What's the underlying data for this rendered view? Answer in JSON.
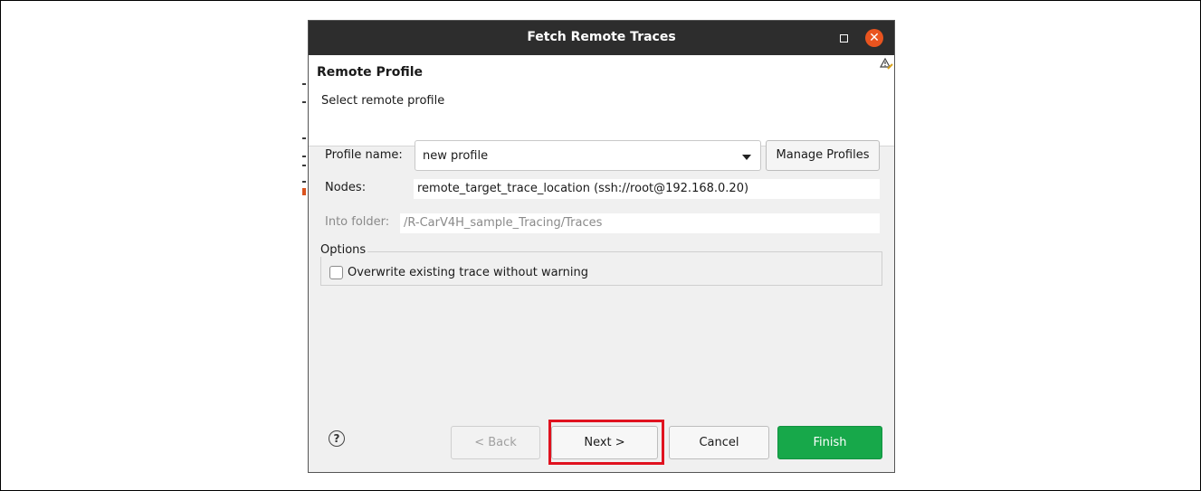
{
  "window": {
    "title": "Fetch Remote Traces",
    "close_glyph": "✕"
  },
  "banner": {
    "title": "Remote Profile",
    "subtitle": "Select remote profile",
    "icon": "warning-wand-icon"
  },
  "form": {
    "profile_label": "Profile name:",
    "profile_value": "new profile",
    "manage_profiles_label": "Manage Profiles",
    "nodes_label": "Nodes:",
    "nodes_value": "remote_target_trace_location (ssh://root@192.168.0.20)",
    "folder_label": "Into folder:",
    "folder_value": "/R-CarV4H_sample_Tracing/Traces"
  },
  "options": {
    "legend": "Options",
    "overwrite_label": "Overwrite existing trace without warning",
    "overwrite_checked": false
  },
  "footer": {
    "help_glyph": "?",
    "back_label": "< Back",
    "next_label": "Next >",
    "cancel_label": "Cancel",
    "finish_label": "Finish"
  },
  "colors": {
    "titlebar": "#2d2d2d",
    "close": "#e9541f",
    "finish": "#17a84a",
    "highlight": "#e0121f"
  }
}
